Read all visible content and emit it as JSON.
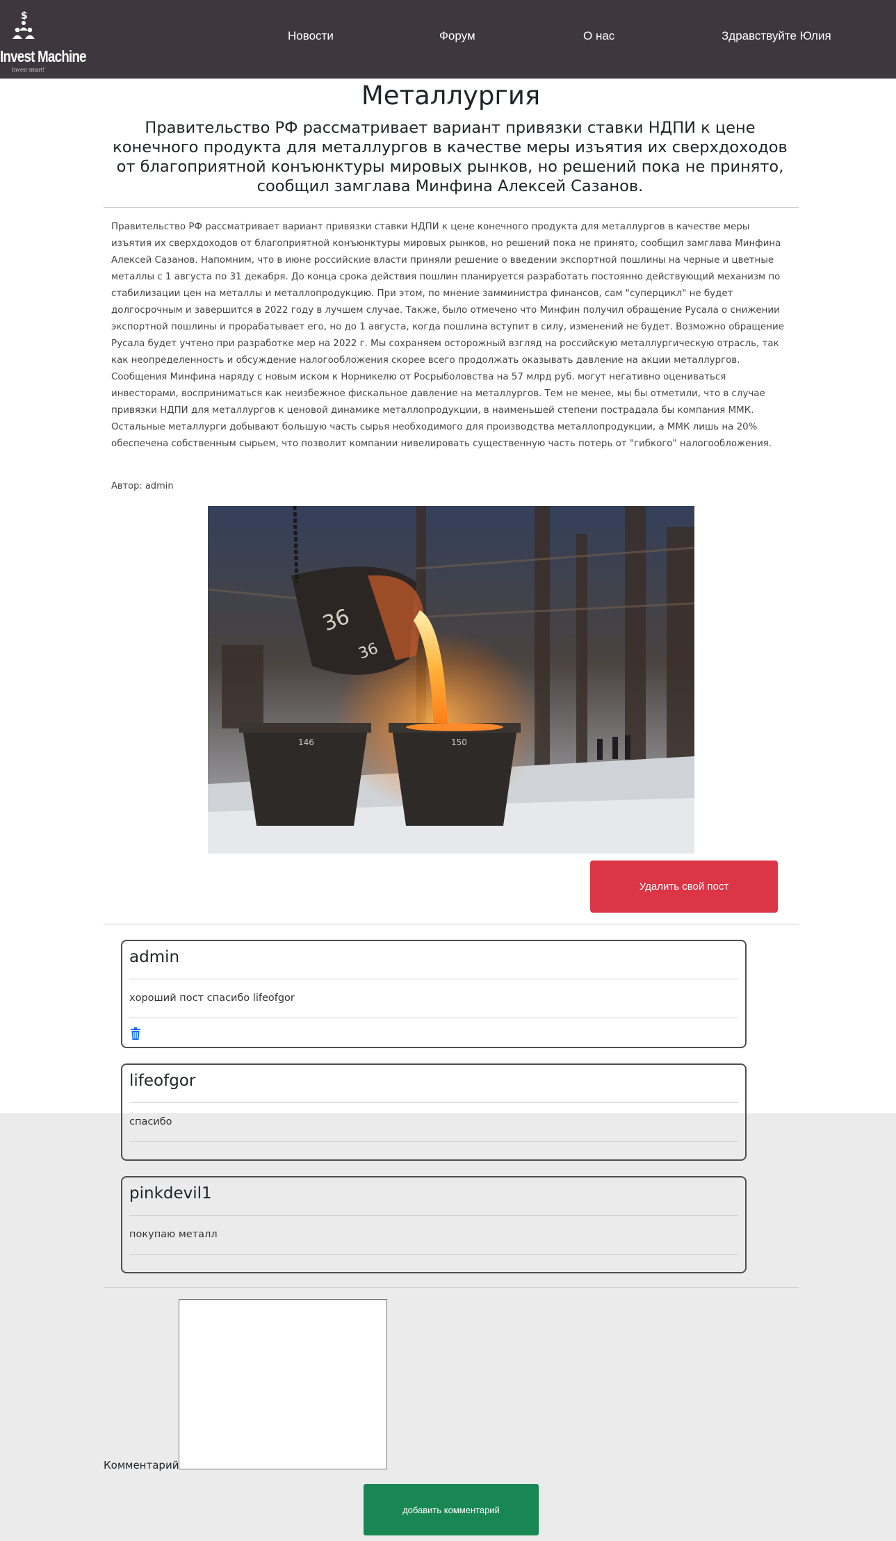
{
  "header": {
    "logo_title": "Invest Machine",
    "logo_subtitle": "Invest smart!",
    "nav": {
      "news": "Новости",
      "forum": "Форум",
      "about": "О нас",
      "greeting": "Здравствуйте Юлия"
    }
  },
  "article": {
    "title": "Металлургия",
    "lead": "Правительство РФ рассматривает вариант привязки ставки НДПИ к цене конечного продукта для металлургов в качестве меры изъятия их сверхдоходов от благоприятной конъюнктуры мировых рынков, но решений пока не принято, сообщил замглава Минфина Алексей Сазанов.",
    "body": "Правительство РФ рассматривает вариант привязки ставки НДПИ к цене конечного продукта для металлургов в качестве меры изъятия их сверхдоходов от благоприятной конъюнктуры мировых рынков, но решений пока не принято, сообщил замглава Минфина Алексей Сазанов. Напомним, что в июне российские власти приняли решение о введении экспортной пошлины на черные и цветные металлы с 1 августа по 31 декабря. До конца срока действия пошлин планируется разработать постоянно действующий механизм по стабилизации цен на металлы и металлопродукцию. При этом, по мнение замминистра финансов, сам \"суперцикл\" не будет долгосрочным и завершится в 2022 году в лучшем случае. Также, было отмечено что Минфин получил обращение Русала о снижении экспортной пошлины и прорабатывает его, но до 1 августа, когда пошлина вступит в силу, изменений не будет. Возможно обращение Русала будет учтено при разработке мер на 2022 г. Мы сохраняем осторожный взгляд на российскую металлургическую отрасль, так как неопределенность и обсуждение налогообложения скорее всего продолжать оказывать давление на акции металлургов. Сообщения Минфина наряду с новым иском к Норникелю от Росрыболовства на 57 млрд руб. могут негативно оцениваться инвесторами, восприниматься как неизбежное фискальное давление на металлургов. Тем не менее, мы бы отметили, что в случае привязки НДПИ для металлургов к ценовой динамике металлопродукции, в наименьшей степени пострадала бы компания ММК. Остальные металлурги добывают большую часть сырья необходимого для производства металлопродукции, а ММК лишь на 20% обеспечена собственным сырьем, что позволит компании нивелировать существенную часть потерь от \"гибкого\" налогообложения.",
    "author": "Автор: admin",
    "delete_label": "Удалить свой пост",
    "image_marks": [
      "36",
      "36",
      "146",
      "150"
    ]
  },
  "comments": [
    {
      "author": "admin",
      "text": "хороший пост спасибо lifeofgor",
      "deletable": true
    },
    {
      "author": "lifeofgor",
      "text": "спасибо",
      "deletable": false
    },
    {
      "author": "pinkdevil1",
      "text": "покупаю металл",
      "deletable": false
    }
  ],
  "form": {
    "label": "Комментарий:",
    "value": "",
    "submit_label": "добавить комментарий"
  },
  "colors": {
    "header_bg": "#3e373e",
    "danger": "#dc3545",
    "success": "#198754",
    "trash_icon": "#0d6efd",
    "footer_bg": "#ebebeb"
  }
}
